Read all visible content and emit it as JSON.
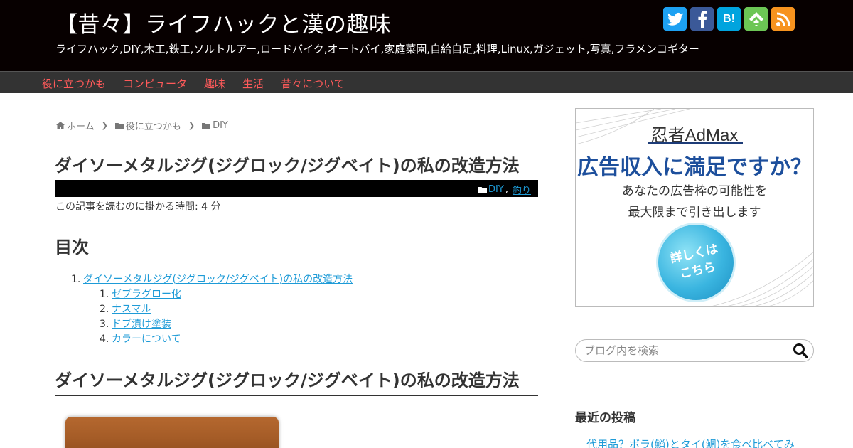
{
  "header": {
    "title": "【昔々】ライフハックと漢の趣味",
    "description": "ライフハック,DIY,木工,鉄工,ソルトルアー,ロードバイク,オートバイ,家庭菜園,自給自足,料理,Linux,ガジェット,写真,フラメンコギター",
    "social": [
      {
        "name": "twitter",
        "glyph": "t",
        "color": "#1da1f2"
      },
      {
        "name": "facebook",
        "glyph": "f",
        "color": "#3b5998"
      },
      {
        "name": "hatena",
        "glyph": "B!",
        "color": "#00a4de"
      },
      {
        "name": "feedly",
        "glyph": "f",
        "color": "#6cc655"
      },
      {
        "name": "rss",
        "glyph": "rss",
        "color": "#f7931e"
      }
    ]
  },
  "nav": {
    "items": [
      "役に立つかも",
      "コンピュータ",
      "趣味",
      "生活",
      "昔々について"
    ]
  },
  "breadcrumb": {
    "home": "ホーム",
    "category": "役に立つかも",
    "subcategory": "DIY"
  },
  "post": {
    "title": "ダイソーメタルジグ(ジグロック/ジグベイト)の私の改造方法",
    "categories": [
      "DIY",
      "釣り"
    ],
    "reading_time": "この記事を読むのに掛かる時間: 4 分"
  },
  "toc": {
    "heading": "目次",
    "items": [
      {
        "num": "1.",
        "label": "ダイソーメタルジグ(ジグロック/ジグベイト)の私の改造方法"
      },
      {
        "num": "1.",
        "label": "ゼブラグロー化"
      },
      {
        "num": "2.",
        "label": "ナスマル"
      },
      {
        "num": "3.",
        "label": "ドブ漬け塗装"
      },
      {
        "num": "4.",
        "label": "カラーについて"
      }
    ]
  },
  "section": {
    "heading": "ダイソーメタルジグ(ジグロック/ジグベイト)の私の改造方法"
  },
  "sidebar": {
    "ad": {
      "brand": "忍者AdMax",
      "headline": "広告収入に満足ですか？",
      "line1": "あなたの広告枠の可能性を",
      "line2": "最大限まで引き出します",
      "cta_line1": "詳しくは",
      "cta_line2": "こちら"
    },
    "search": {
      "placeholder": "ブログ内を検索"
    },
    "recent": {
      "heading": "最近の投稿",
      "items": [
        "代用品？ボラ(鯔)とタイ(鯛)を食べ比べてみ"
      ]
    }
  },
  "colors": {
    "header_bg": "#070000",
    "nav_bg": "#333333",
    "nav_text": "#ff5a5a",
    "link": "#1e9bd7",
    "ad_blue": "#1d4f9c"
  }
}
